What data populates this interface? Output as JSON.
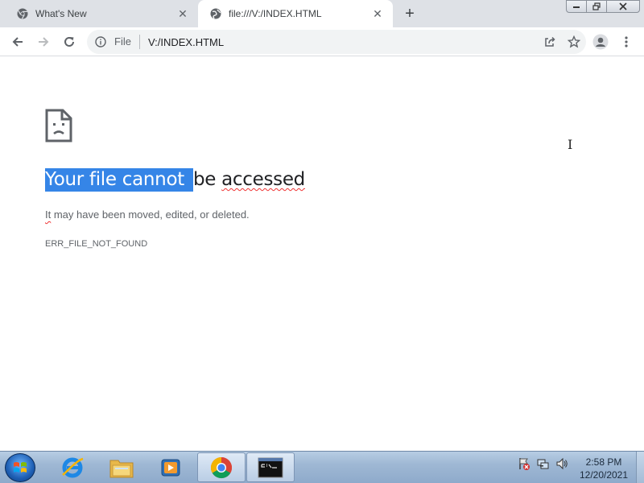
{
  "tabs": [
    {
      "title": "What's New",
      "favicon": "chrome-icon",
      "active": false
    },
    {
      "title": "file:///V:/INDEX.HTML",
      "favicon": "globe-icon",
      "active": true
    }
  ],
  "omnibox": {
    "scheme_label": "File",
    "url": "V:/INDEX.HTML"
  },
  "error_page": {
    "heading_selected": "Your file cannot ",
    "heading_plain": "be ",
    "heading_misspelled": "accessed",
    "subtext_misspelled": "It",
    "subtext_rest": " may have been moved, edited, or deleted.",
    "error_code": "ERR_FILE_NOT_FOUND"
  },
  "taskbar": {
    "items": [
      {
        "name": "internet-explorer-icon"
      },
      {
        "name": "file-explorer-icon"
      },
      {
        "name": "media-player-icon"
      },
      {
        "name": "chrome-icon",
        "active": true
      },
      {
        "name": "command-prompt-icon",
        "active": true
      }
    ],
    "clock_time": "2:58 PM",
    "clock_date": "12/20/2021"
  },
  "colors": {
    "selection": "#3585e7",
    "tabstrip": "#dee1e6",
    "omnibox": "#f1f3f4",
    "spellcheck": "#e33333"
  }
}
